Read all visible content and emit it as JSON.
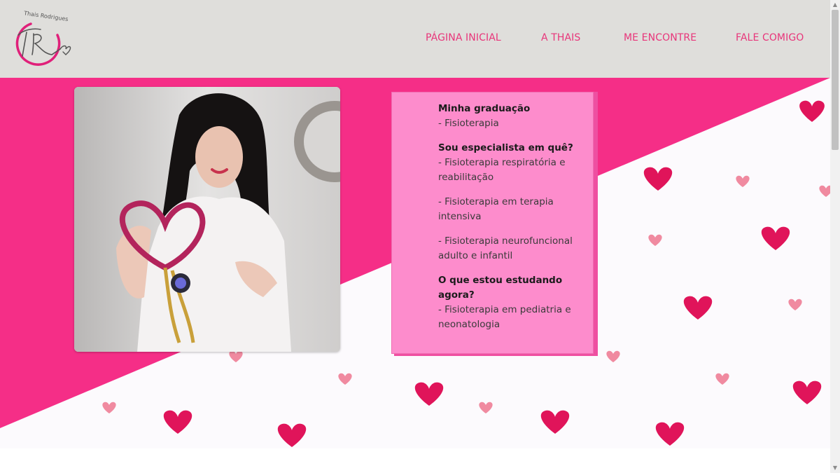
{
  "brand": {
    "logo_text": "Thais Rodrigues",
    "logo_initials": "TR"
  },
  "nav": {
    "items": [
      {
        "label": "PÁGINA INICIAL"
      },
      {
        "label": "A THAIS"
      },
      {
        "label": "ME ENCONTRE"
      },
      {
        "label": "FALE COMIGO"
      }
    ]
  },
  "card": {
    "sections": [
      {
        "heading": "Minha graduação",
        "items": [
          "- Fisioterapia"
        ]
      },
      {
        "heading": "Sou especialista em quê?",
        "items": [
          "- Fisioterapia respiratória e reabilitação",
          "- Fisioterapia em terapia intensiva",
          "- Fisioterapia neurofuncional adulto e infantil"
        ]
      },
      {
        "heading": "O que estou estudando agora?",
        "items": [
          "- Fisioterapia em pediatria e neonatologia"
        ]
      }
    ]
  },
  "colors": {
    "header_bg": "#dfdedb",
    "nav_text": "#e8357a",
    "hero_pink": "#f52e87",
    "card_bg": "#fd8ccc",
    "heart_dark": "#e0145a",
    "heart_light": "#f08aa0"
  },
  "icons": {
    "logo": "signature-logo",
    "hearts": "heart-icon",
    "scroll_up": "scroll-up-arrow-icon",
    "scroll_down": "scroll-down-arrow-icon"
  }
}
